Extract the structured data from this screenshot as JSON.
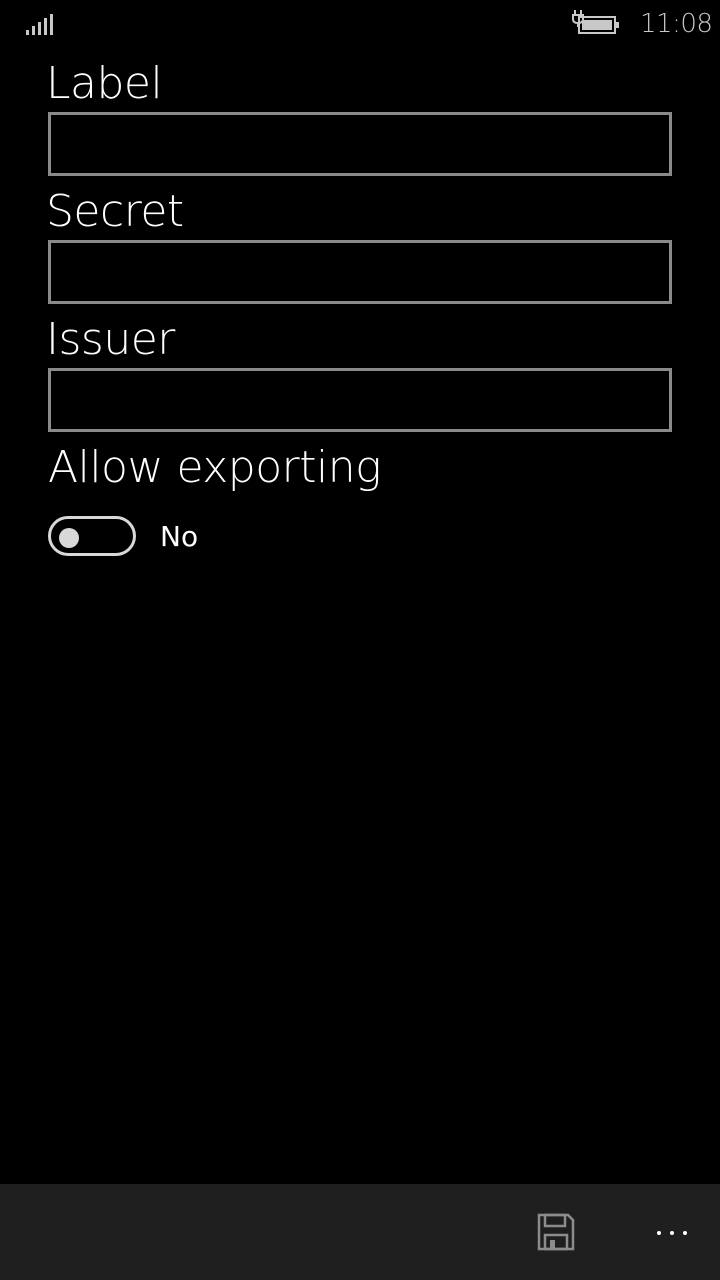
{
  "status_bar": {
    "time": "11:08",
    "signal_icon": "signal-bars-icon",
    "battery_icon": "battery-charging-icon"
  },
  "form": {
    "label": {
      "caption": "Label",
      "value": "",
      "placeholder": ""
    },
    "secret": {
      "caption": "Secret",
      "value": "",
      "placeholder": ""
    },
    "issuer": {
      "caption": "Issuer",
      "value": "",
      "placeholder": ""
    },
    "allow_exporting": {
      "caption": "Allow exporting",
      "state_label": "No",
      "on": false
    }
  },
  "app_bar": {
    "background": "#1f1f1f",
    "save_icon": "save-icon",
    "more_icon": "ellipsis-icon"
  },
  "colors": {
    "background": "#000000",
    "text": "#ffffff",
    "input_border": "#8a8a8a",
    "toggle": "#d8d8d8"
  }
}
